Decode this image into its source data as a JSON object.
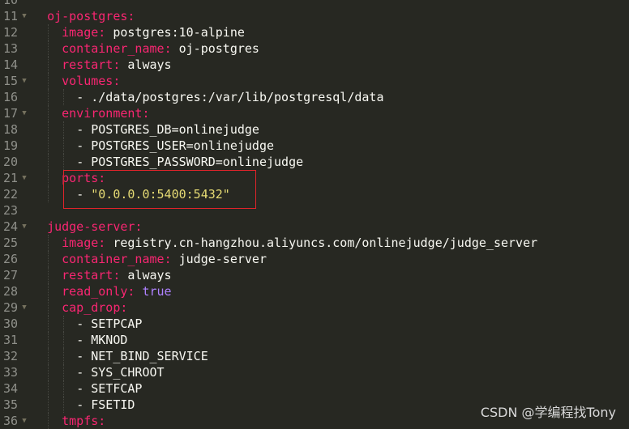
{
  "editor": {
    "lines": [
      {
        "n": "10",
        "text": ""
      },
      {
        "n": "11",
        "key": "oj-postgres",
        "fold": true,
        "indent": 2
      },
      {
        "n": "12",
        "key": "image",
        "val": "postgres:10-alpine",
        "indent": 4
      },
      {
        "n": "13",
        "key": "container_name",
        "val": "oj-postgres",
        "indent": 4
      },
      {
        "n": "14",
        "key": "restart",
        "val": "always",
        "indent": 4
      },
      {
        "n": "15",
        "key": "volumes",
        "fold": true,
        "indent": 4
      },
      {
        "n": "16",
        "item": "./data/postgres:/var/lib/postgresql/data",
        "indent": 6
      },
      {
        "n": "17",
        "key": "environment",
        "fold": true,
        "indent": 4
      },
      {
        "n": "18",
        "item": "POSTGRES_DB=onlinejudge",
        "indent": 6
      },
      {
        "n": "19",
        "item": "POSTGRES_USER=onlinejudge",
        "indent": 6
      },
      {
        "n": "20",
        "item": "POSTGRES_PASSWORD=onlinejudge",
        "indent": 6
      },
      {
        "n": "21",
        "key": "ports",
        "fold": true,
        "indent": 4
      },
      {
        "n": "22",
        "item": "\"0.0.0.0:5400:5432\"",
        "itemType": "string",
        "indent": 6
      },
      {
        "n": "23",
        "text": ""
      },
      {
        "n": "24",
        "key": "judge-server",
        "fold": true,
        "indent": 2
      },
      {
        "n": "25",
        "key": "image",
        "val": "registry.cn-hangzhou.aliyuncs.com/onlinejudge/judge_server",
        "indent": 4
      },
      {
        "n": "26",
        "key": "container_name",
        "val": "judge-server",
        "indent": 4
      },
      {
        "n": "27",
        "key": "restart",
        "val": "always",
        "indent": 4
      },
      {
        "n": "28",
        "key": "read_only",
        "val": "true",
        "valType": "bool",
        "indent": 4
      },
      {
        "n": "29",
        "key": "cap_drop",
        "fold": true,
        "indent": 4
      },
      {
        "n": "30",
        "item": "SETPCAP",
        "indent": 6
      },
      {
        "n": "31",
        "item": "MKNOD",
        "indent": 6
      },
      {
        "n": "32",
        "item": "NET_BIND_SERVICE",
        "indent": 6
      },
      {
        "n": "33",
        "item": "SYS_CHROOT",
        "indent": 6
      },
      {
        "n": "34",
        "item": "SETFCAP",
        "indent": 6
      },
      {
        "n": "35",
        "item": "FSETID",
        "indent": 6
      },
      {
        "n": "36",
        "key": "tmpfs",
        "fold": true,
        "indent": 4
      }
    ]
  },
  "watermark": "CSDN @学编程找Tony",
  "colors": {
    "background": "#272822",
    "key": "#f92672",
    "string": "#e6db74",
    "boolean": "#ae81ff",
    "highlight_box": "#e0242a"
  }
}
